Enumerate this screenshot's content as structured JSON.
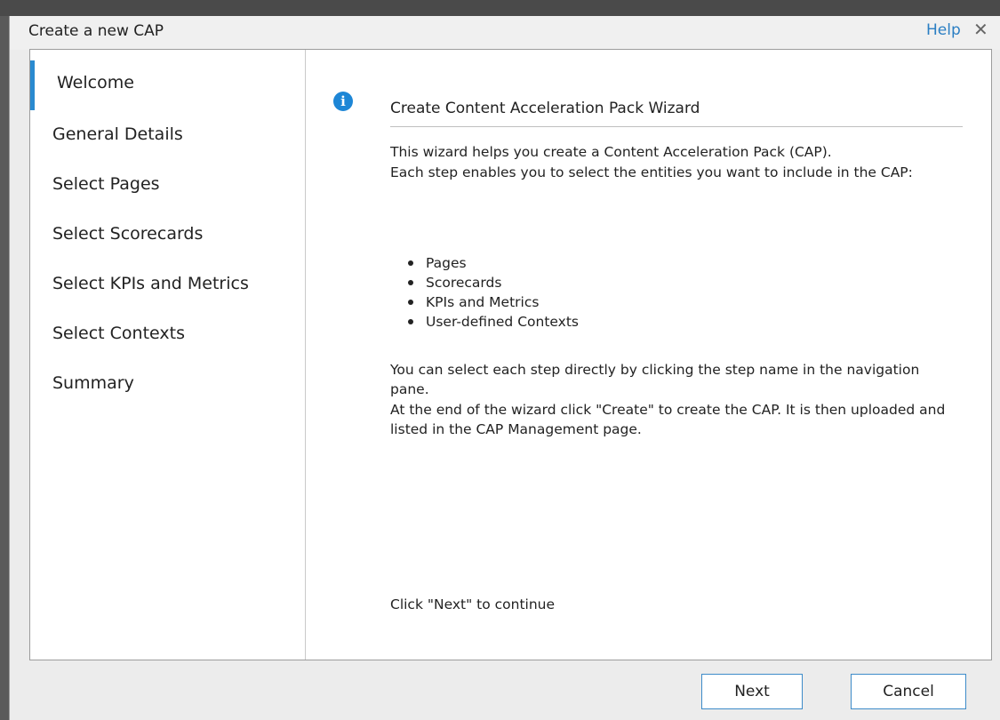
{
  "dialog": {
    "title": "Create a new CAP",
    "help_label": "Help",
    "close_glyph": "✕"
  },
  "nav": {
    "items": [
      {
        "label": "Welcome",
        "active": true
      },
      {
        "label": "General Details"
      },
      {
        "label": "Select Pages"
      },
      {
        "label": "Select Scorecards"
      },
      {
        "label": "Select KPIs and Metrics"
      },
      {
        "label": "Select Contexts"
      },
      {
        "label": "Summary"
      }
    ]
  },
  "content": {
    "info_icon": "info-icon",
    "heading": "Create Content Acceleration Pack Wizard",
    "intro_1": "This wizard helps you create a Content Acceleration Pack (CAP).",
    "intro_2": "Each step enables you to select the entities you want to include in the CAP:",
    "bullets": [
      "Pages",
      "Scorecards",
      "KPIs and Metrics",
      "User-defined Contexts"
    ],
    "para_1": "You can select each step directly by clicking the step name in the navigation pane.",
    "para_2": "At the end of the wizard click \"Create\" to create the CAP. It is then uploaded and listed in the CAP Management page.",
    "footer_hint": "Click \"Next\" to continue"
  },
  "buttons": {
    "next": "Next",
    "cancel": "Cancel"
  },
  "colors": {
    "accent": "#2a8ad0",
    "help_link": "#2a7ec3",
    "button_border": "#3d8bc9"
  }
}
